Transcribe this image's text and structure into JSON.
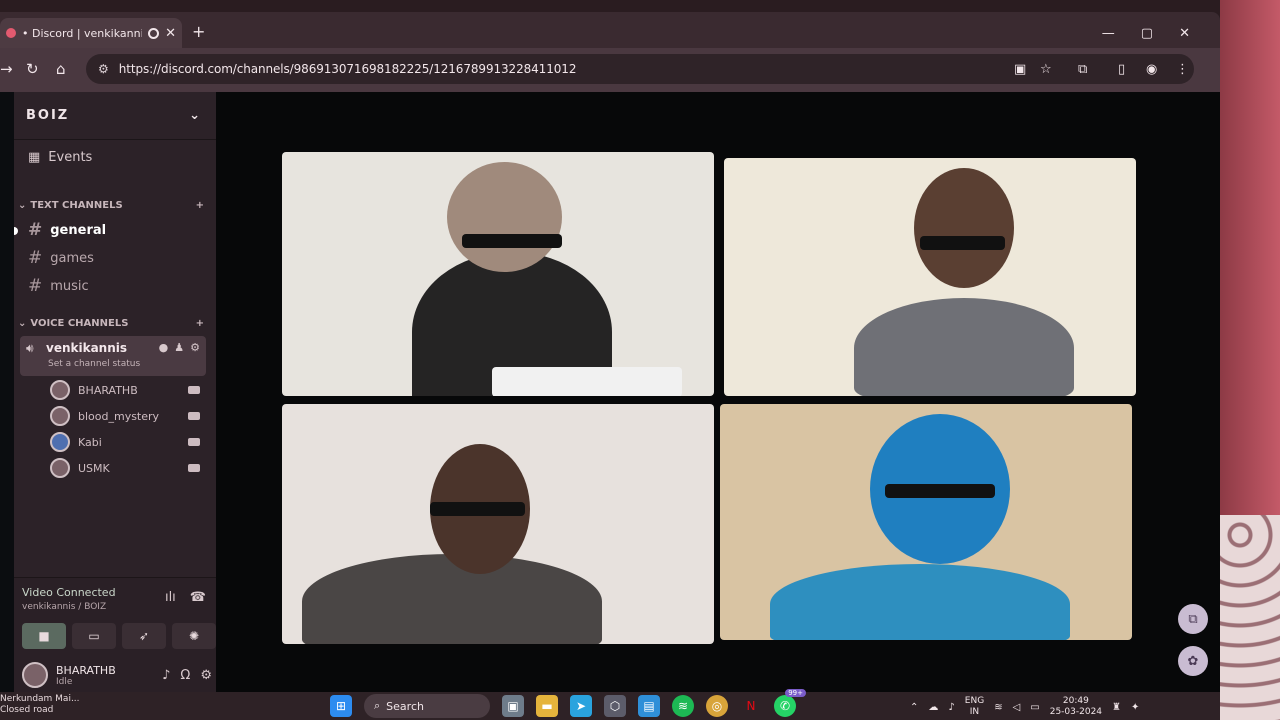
{
  "browser": {
    "tab_title": "• Discord | venkikannis | B O",
    "tab_close": "✕",
    "new_tab": "+",
    "url": "https://discord.com/channels/986913071698182225/1216789913228411012",
    "window_controls": [
      "—",
      "▢",
      "✕"
    ]
  },
  "server": {
    "name": "BOIZ",
    "events_label": "Events",
    "text_category": "TEXT CHANNELS",
    "voice_category": "VOICE CHANNELS",
    "text_channels": [
      {
        "name": "general",
        "active": true
      },
      {
        "name": "games",
        "active": false
      },
      {
        "name": "music",
        "active": false
      }
    ],
    "voice_channel": {
      "name": "venkikannis",
      "status": "Set a channel status"
    },
    "members": [
      {
        "name": "BHARATHB",
        "icon": "avatar"
      },
      {
        "name": "blood_mystery",
        "icon": "avatar"
      },
      {
        "name": "Kabi",
        "icon": "discord-default-avatar"
      },
      {
        "name": "USMK",
        "icon": "avatar"
      }
    ]
  },
  "voice_panel": {
    "status": "Video Connected",
    "location": "venkikannis / BOIZ"
  },
  "user": {
    "name": "BHARATHB",
    "status": "Idle"
  },
  "taskbar": {
    "weather_title": "Nerkundam Mai...",
    "weather_sub": "Closed road",
    "search_label": "Search",
    "badge": "99+",
    "lang_1": "ENG",
    "lang_2": "IN",
    "time": "20:49",
    "date": "25-03-2024"
  },
  "colors": {
    "sidebar": "#2c2228",
    "accent_video": "#5b6a60",
    "stage_bg": "#070809"
  }
}
